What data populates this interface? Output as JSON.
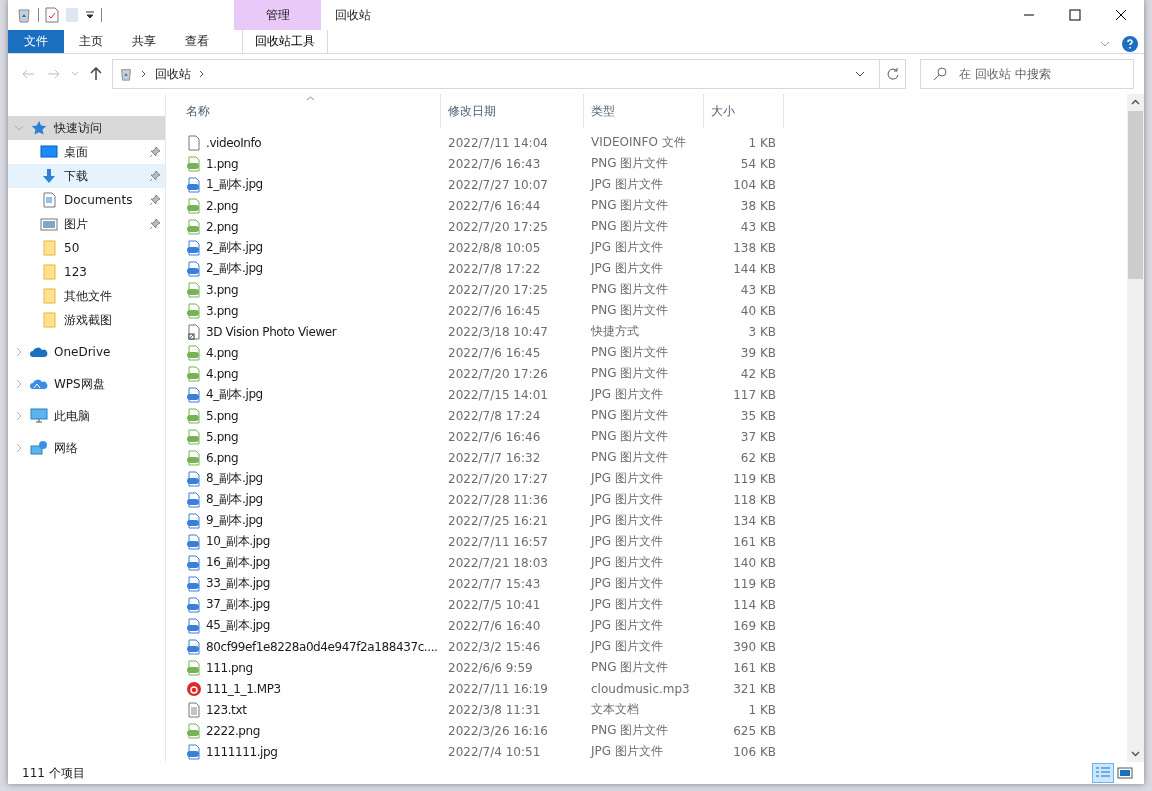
{
  "window": {
    "title": "回收站",
    "context_tab": "管理"
  },
  "ribbon_tabs": [
    {
      "label": "文件",
      "kind": "file"
    },
    {
      "label": "主页",
      "kind": "tab"
    },
    {
      "label": "共享",
      "kind": "tab"
    },
    {
      "label": "查看",
      "kind": "tab"
    },
    {
      "label": "回收站工具",
      "kind": "context"
    }
  ],
  "address": {
    "crumbs": [
      "回收站"
    ]
  },
  "search": {
    "placeholder": "在 回收站 中搜索"
  },
  "sidebar": {
    "items": [
      {
        "label": "快速访问",
        "selected": true,
        "expanded": true,
        "children": [
          {
            "label": "桌面",
            "pinned": true,
            "hovered": false
          },
          {
            "label": "下载",
            "pinned": true,
            "hovered": true
          },
          {
            "label": "Documents",
            "pinned": true,
            "hovered": false
          },
          {
            "label": "图片",
            "pinned": true,
            "hovered": false
          },
          {
            "label": "50",
            "pinned": false,
            "hovered": false
          },
          {
            "label": "123",
            "pinned": false,
            "hovered": false
          },
          {
            "label": "其他文件",
            "pinned": false,
            "hovered": false
          },
          {
            "label": "游戏截图",
            "pinned": false,
            "hovered": false
          }
        ]
      },
      {
        "label": "OneDrive",
        "selected": false,
        "expanded": false
      },
      {
        "label": "WPS网盘",
        "selected": false,
        "expanded": false
      },
      {
        "label": "此电脑",
        "selected": false,
        "expanded": false
      },
      {
        "label": "网络",
        "selected": false,
        "expanded": false
      }
    ]
  },
  "table": {
    "columns": [
      "名称",
      "修改日期",
      "类型",
      "大小"
    ],
    "rows": [
      {
        "name": ".videoInfo",
        "date": "2022/7/11 14:04",
        "type": "VIDEOINFO 文件",
        "size": "1 KB",
        "kind": "blank"
      },
      {
        "name": "1.png",
        "date": "2022/7/6 16:43",
        "type": "PNG 图片文件",
        "size": "54 KB",
        "kind": "png"
      },
      {
        "name": "1_副本.jpg",
        "date": "2022/7/27 10:07",
        "type": "JPG 图片文件",
        "size": "104 KB",
        "kind": "jpg"
      },
      {
        "name": "2.png",
        "date": "2022/7/6 16:44",
        "type": "PNG 图片文件",
        "size": "38 KB",
        "kind": "png"
      },
      {
        "name": "2.png",
        "date": "2022/7/20 17:25",
        "type": "PNG 图片文件",
        "size": "43 KB",
        "kind": "png"
      },
      {
        "name": "2_副本.jpg",
        "date": "2022/8/8 10:05",
        "type": "JPG 图片文件",
        "size": "138 KB",
        "kind": "jpg"
      },
      {
        "name": "2_副本.jpg",
        "date": "2022/7/8 17:22",
        "type": "JPG 图片文件",
        "size": "144 KB",
        "kind": "jpg"
      },
      {
        "name": "3.png",
        "date": "2022/7/20 17:25",
        "type": "PNG 图片文件",
        "size": "43 KB",
        "kind": "png"
      },
      {
        "name": "3.png",
        "date": "2022/7/6 16:45",
        "type": "PNG 图片文件",
        "size": "40 KB",
        "kind": "png"
      },
      {
        "name": "3D Vision Photo Viewer",
        "date": "2022/3/18 10:47",
        "type": "快捷方式",
        "size": "3 KB",
        "kind": "shortcut"
      },
      {
        "name": "4.png",
        "date": "2022/7/6 16:45",
        "type": "PNG 图片文件",
        "size": "39 KB",
        "kind": "png"
      },
      {
        "name": "4.png",
        "date": "2022/7/20 17:26",
        "type": "PNG 图片文件",
        "size": "42 KB",
        "kind": "png"
      },
      {
        "name": "4_副本.jpg",
        "date": "2022/7/15 14:01",
        "type": "JPG 图片文件",
        "size": "117 KB",
        "kind": "jpg"
      },
      {
        "name": "5.png",
        "date": "2022/7/8 17:24",
        "type": "PNG 图片文件",
        "size": "35 KB",
        "kind": "png"
      },
      {
        "name": "5.png",
        "date": "2022/7/6 16:46",
        "type": "PNG 图片文件",
        "size": "37 KB",
        "kind": "png"
      },
      {
        "name": "6.png",
        "date": "2022/7/7 16:32",
        "type": "PNG 图片文件",
        "size": "62 KB",
        "kind": "png"
      },
      {
        "name": "8_副本.jpg",
        "date": "2022/7/20 17:27",
        "type": "JPG 图片文件",
        "size": "119 KB",
        "kind": "jpg"
      },
      {
        "name": "8_副本.jpg",
        "date": "2022/7/28 11:36",
        "type": "JPG 图片文件",
        "size": "118 KB",
        "kind": "jpg"
      },
      {
        "name": "9_副本.jpg",
        "date": "2022/7/25 16:21",
        "type": "JPG 图片文件",
        "size": "134 KB",
        "kind": "jpg"
      },
      {
        "name": "10_副本.jpg",
        "date": "2022/7/11 16:57",
        "type": "JPG 图片文件",
        "size": "161 KB",
        "kind": "jpg"
      },
      {
        "name": "16_副本.jpg",
        "date": "2022/7/21 18:03",
        "type": "JPG 图片文件",
        "size": "140 KB",
        "kind": "jpg"
      },
      {
        "name": "33_副本.jpg",
        "date": "2022/7/7 15:43",
        "type": "JPG 图片文件",
        "size": "119 KB",
        "kind": "jpg"
      },
      {
        "name": "37_副本.jpg",
        "date": "2022/7/5 10:41",
        "type": "JPG 图片文件",
        "size": "114 KB",
        "kind": "jpg"
      },
      {
        "name": "45_副本.jpg",
        "date": "2022/7/6 16:40",
        "type": "JPG 图片文件",
        "size": "169 KB",
        "kind": "jpg"
      },
      {
        "name": "80cf99ef1e8228a0d4e947f2a188437c....",
        "date": "2022/3/2 15:46",
        "type": "JPG 图片文件",
        "size": "390 KB",
        "kind": "jpg"
      },
      {
        "name": "111.png",
        "date": "2022/6/6 9:59",
        "type": "PNG 图片文件",
        "size": "161 KB",
        "kind": "png"
      },
      {
        "name": "111_1_1.MP3",
        "date": "2022/7/11 16:19",
        "type": "cloudmusic.mp3",
        "size": "321 KB",
        "kind": "music"
      },
      {
        "name": "123.txt",
        "date": "2022/3/8 11:31",
        "type": "文本文档",
        "size": "1 KB",
        "kind": "text"
      },
      {
        "name": "2222.png",
        "date": "2022/3/26 16:16",
        "type": "PNG 图片文件",
        "size": "625 KB",
        "kind": "png"
      },
      {
        "name": "1111111.jpg",
        "date": "2022/7/4 10:51",
        "type": "JPG 图片文件",
        "size": "106 KB",
        "kind": "jpg"
      }
    ]
  },
  "status_bar": {
    "count": "111 个项目",
    "views": [
      {
        "kind": "details",
        "selected": true
      },
      {
        "kind": "large",
        "selected": false
      }
    ]
  }
}
